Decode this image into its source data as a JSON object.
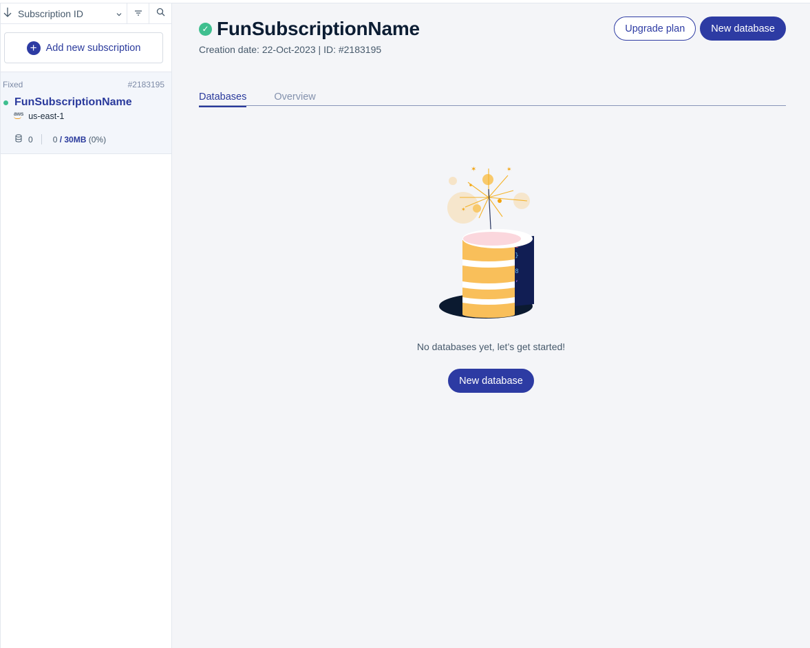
{
  "sidebar": {
    "sort_label": "Subscription ID",
    "add_label": "Add new subscription",
    "subscriptions": [
      {
        "plan": "Fixed",
        "id": "#2183195",
        "name": "FunSubscriptionName",
        "region": "us-east-1",
        "provider": "aws",
        "db_count": "0",
        "memory_used": "0",
        "memory_total": "/ 30MB",
        "memory_pct": "(0%)"
      }
    ]
  },
  "main": {
    "title": "FunSubscriptionName",
    "meta": "Creation date: 22-Oct-2023 | ID: #2183195",
    "upgrade_label": "Upgrade plan",
    "new_db_label": "New database",
    "tabs": [
      {
        "label": "Databases"
      },
      {
        "label": "Overview"
      }
    ],
    "empty_text": "No databases yet, let’s get started!",
    "empty_button": "New database"
  },
  "colors": {
    "accent": "#2d3ba3",
    "status_green": "#3fbf8f",
    "background": "#f4f5f8"
  }
}
